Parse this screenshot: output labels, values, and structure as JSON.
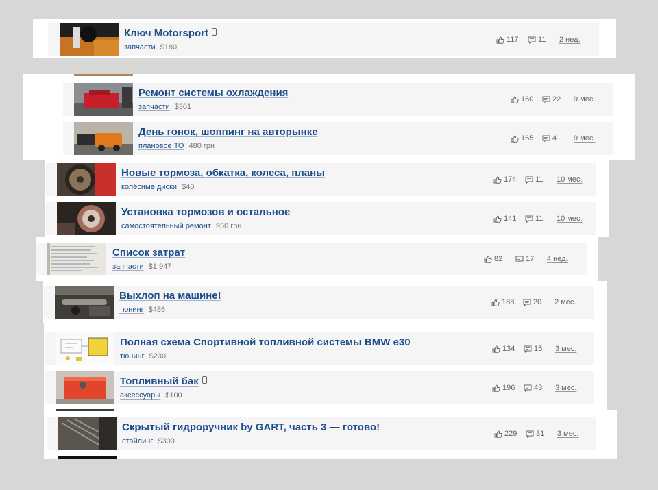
{
  "posts": [
    {
      "title": "Ключ Motorsport",
      "mobile": true,
      "category": "запчасти",
      "price": "$180",
      "likes": "117",
      "comments": "11",
      "date": "2 нед."
    },
    {
      "title": "Ремонт системы охлаждения",
      "mobile": false,
      "category": "запчасти",
      "price": "$301",
      "likes": "160",
      "comments": "22",
      "date": "9 мес."
    },
    {
      "title": "День гонок, шоппинг на авторынке",
      "mobile": false,
      "category": "плановое ТО",
      "price": "480 грн",
      "likes": "165",
      "comments": "4",
      "date": "9 мес."
    },
    {
      "title": "Новые тормоза, обкатка, колеса, планы",
      "mobile": false,
      "category": "колёсные диски",
      "price": "$40",
      "likes": "174",
      "comments": "11",
      "date": "10 мес."
    },
    {
      "title": "Установка тормозов и остальное",
      "mobile": false,
      "category": "самостоятельный ремонт",
      "price": "950 грн",
      "likes": "141",
      "comments": "11",
      "date": "10 мес."
    },
    {
      "title": "Список затрат",
      "mobile": false,
      "category": "запчасти",
      "price": "$1,947",
      "likes": "82",
      "comments": "17",
      "date": "4 нед."
    },
    {
      "title": "Выхлоп на машине!",
      "mobile": false,
      "category": "тюнинг",
      "price": "$486",
      "likes": "188",
      "comments": "20",
      "date": "2 мес."
    },
    {
      "title": "Полная схема Спортивной топливной системы BMW e30",
      "mobile": false,
      "category": "тюнинг",
      "price": "$230",
      "likes": "134",
      "comments": "15",
      "date": "3 мес."
    },
    {
      "title": "Топливный бак",
      "mobile": true,
      "category": "аксессуары",
      "price": "$100",
      "likes": "196",
      "comments": "43",
      "date": "3 мес."
    },
    {
      "title": "Скрытый гидроручник by GART, часть 3 — готово!",
      "mobile": false,
      "category": "стайлинг",
      "price": "$300",
      "likes": "229",
      "comments": "31",
      "date": "3 мес."
    }
  ],
  "icons": {
    "like": "thumbs-up-icon",
    "comment": "comment-icon",
    "mobile": "phone-icon"
  },
  "colors": {
    "link": "#1e4d8c",
    "card": "#f5f5f5",
    "background": "#d7d7d7"
  }
}
